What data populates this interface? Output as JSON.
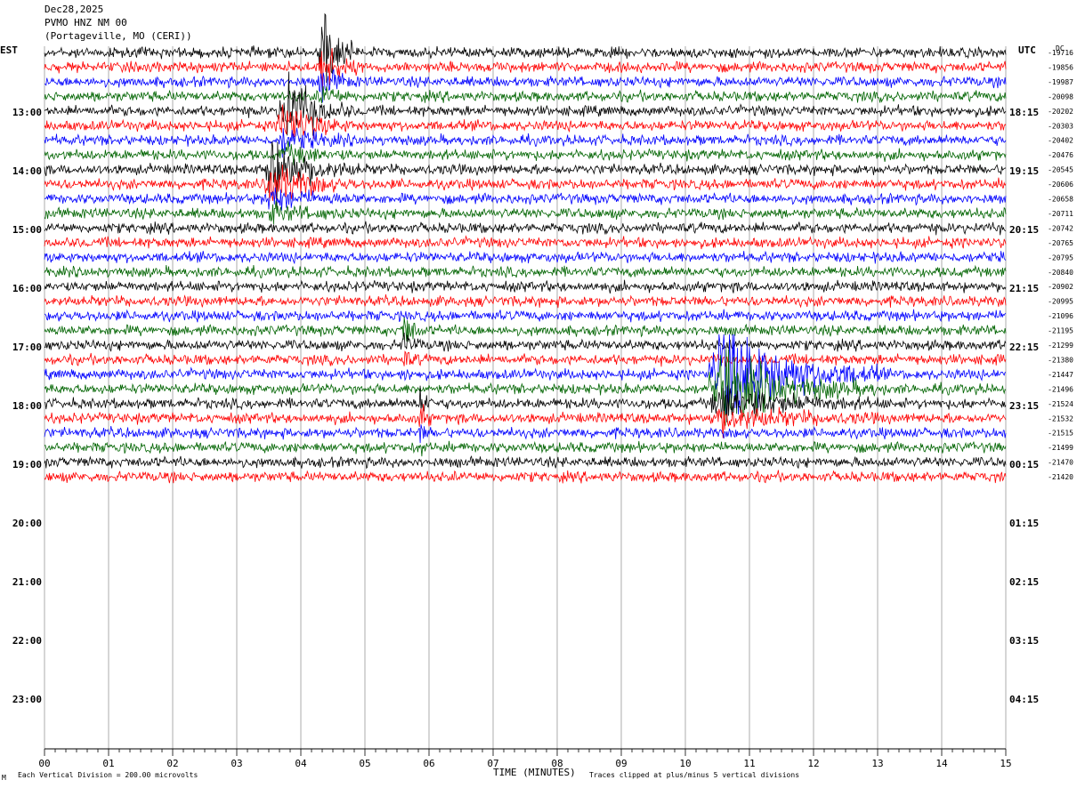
{
  "header": {
    "date": "Dec28,2025",
    "station": "PVMO HNZ NM 00",
    "location": "(Portageville, MO (CERI))"
  },
  "left_timezone": "EST",
  "right_timezone": "UTC",
  "dc_label": "DC",
  "footer": {
    "scale_note": "Each Vertical Division =  200.00 microvolts",
    "clip_note": "Traces clipped at plus/minus 5 vertical divisions",
    "corner_mark": "M"
  },
  "chart_data": {
    "type": "line",
    "xlabel": "TIME (MINUTES)",
    "xlim": [
      0,
      15
    ],
    "x_ticks": [
      "00",
      "01",
      "02",
      "03",
      "04",
      "05",
      "06",
      "07",
      "08",
      "09",
      "10",
      "11",
      "12",
      "13",
      "14",
      "15"
    ],
    "left_hour_labels": [
      "13:00",
      "14:00",
      "15:00",
      "16:00",
      "17:00",
      "18:00",
      "19:00",
      "20:00",
      "21:00",
      "22:00",
      "23:00"
    ],
    "right_hour_labels": [
      "18:15",
      "19:15",
      "20:15",
      "21:15",
      "22:15",
      "23:15",
      "00:15",
      "01:15",
      "02:15",
      "03:15",
      "04:15"
    ],
    "trace_colors": [
      "#000000",
      "#ff0000",
      "#0000ff",
      "#006400"
    ],
    "trace_count": 30,
    "dc_offsets": [
      "-19716",
      "-19856",
      "-19987",
      "-20098",
      "-20202",
      "-20303",
      "-20402",
      "-20476",
      "-20545",
      "-20606",
      "-20658",
      "-20711",
      "-20742",
      "-20765",
      "-20795",
      "-20840",
      "-20902",
      "-20995",
      "-21096",
      "-21195",
      "-21299",
      "-21380",
      "-21447",
      "-21496",
      "-21524",
      "-21532",
      "-21515",
      "-21499",
      "-21470",
      "-21420"
    ],
    "events": [
      {
        "trace": 0,
        "minute": 4.3,
        "duration": 0.6,
        "amp": 6,
        "color_trace": 1
      },
      {
        "trace": 4,
        "minute": 3.7,
        "duration": 1.1,
        "amp": 5
      },
      {
        "trace": 8,
        "minute": 3.5,
        "duration": 1.4,
        "amp": 4
      },
      {
        "trace": 19,
        "minute": 5.6,
        "duration": 0.3,
        "amp": 3
      },
      {
        "trace": 24,
        "minute": 5.85,
        "duration": 0.2,
        "amp": 4
      },
      {
        "trace": 22,
        "minute": 10.5,
        "duration": 2.6,
        "amp": 7
      }
    ]
  }
}
